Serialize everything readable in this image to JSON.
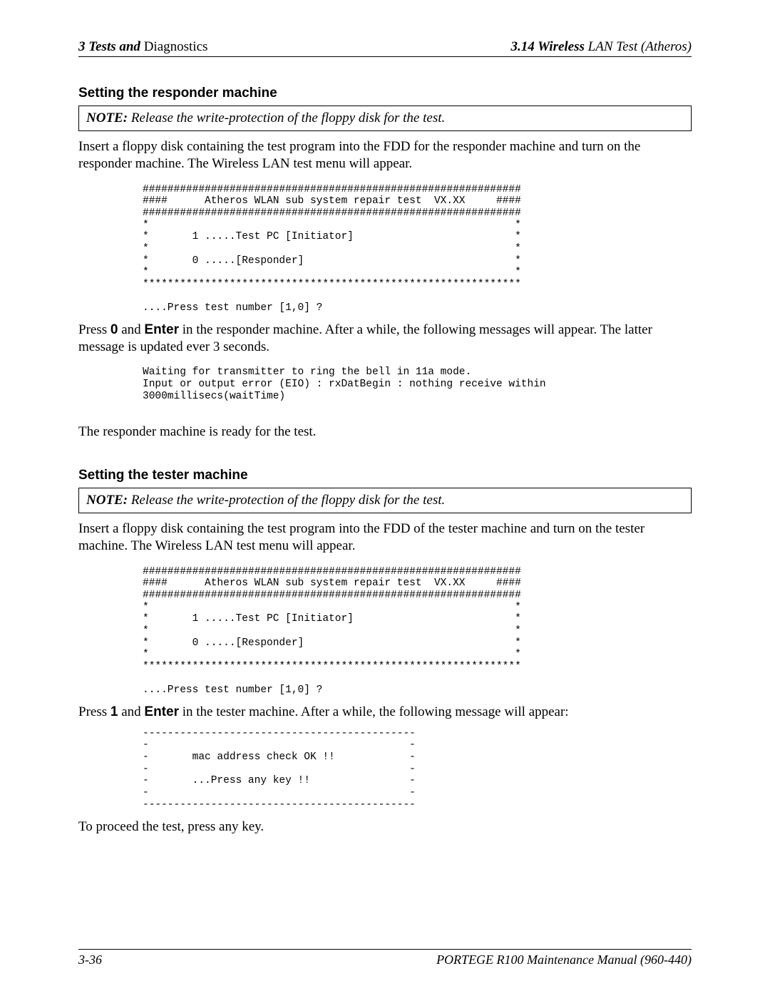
{
  "header": {
    "left_chapter": "3",
    "left_bold_ital": "Tests and",
    "left_rest": " Diagnostics",
    "right_num": "3.14",
    "right_bold": "  Wireless",
    "right_rest": " LAN Test  (Atheros)"
  },
  "section1": {
    "heading": "Setting the responder machine",
    "note_label": "NOTE:",
    "note_body": "  Release the write-protection of the floppy disk for the test.",
    "para": "Insert a floppy disk containing the test program into the FDD for the responder machine and turn on the responder machine. The Wireless LAN test menu will appear.",
    "terminal": "#############################################################\n####      Atheros WLAN sub system repair test  VX.XX     ####\n#############################################################\n*                                                           *\n*       1 .....Test PC [Initiator]                          *\n*                                                           *\n*       0 .....[Responder]                                  *\n*                                                           *\n*************************************************************\n\n....Press test number [1,0] ?",
    "after1_a": "Press ",
    "after1_key1": "0",
    "after1_b": " and ",
    "after1_key2": "Enter",
    "after1_c": " in the responder machine. After a while, the following messages will appear. The latter message is updated ever 3 seconds.",
    "terminal2": "Waiting for transmitter to ring the bell in 11a mode.\nInput or output error (EIO) : rxDatBegin : nothing receive within\n3000millisecs(waitTime)",
    "ready": "The responder machine is ready for the test."
  },
  "section2": {
    "heading": "Setting the tester machine",
    "note_label": "NOTE:",
    "note_body": "  Release the write-protection of the floppy disk for the test.",
    "para": "Insert a floppy disk containing the test program into the FDD of the tester machine and turn on the tester machine. The Wireless LAN test menu will appear.",
    "terminal": "#############################################################\n####      Atheros WLAN sub system repair test  VX.XX     ####\n#############################################################\n*                                                           *\n*       1 .....Test PC [Initiator]                          *\n*                                                           *\n*       0 .....[Responder]                                  *\n*                                                           *\n*************************************************************\n\n....Press test number [1,0] ?",
    "after2_a": "Press ",
    "after2_key1": "1",
    "after2_b": " and ",
    "after2_key2": "Enter",
    "after2_c": " in the tester machine. After a while, the following message will appear:",
    "terminal2": "--------------------------------------------\n-                                          -\n-       mac address check OK !!            -\n-                                          -\n-       ...Press any key !!                -\n-                                          -\n--------------------------------------------",
    "proceed": "To proceed the test, press any key."
  },
  "footer": {
    "page": "3-36",
    "manual": "PORTEGE R100 Maintenance Manual (960-440)"
  }
}
